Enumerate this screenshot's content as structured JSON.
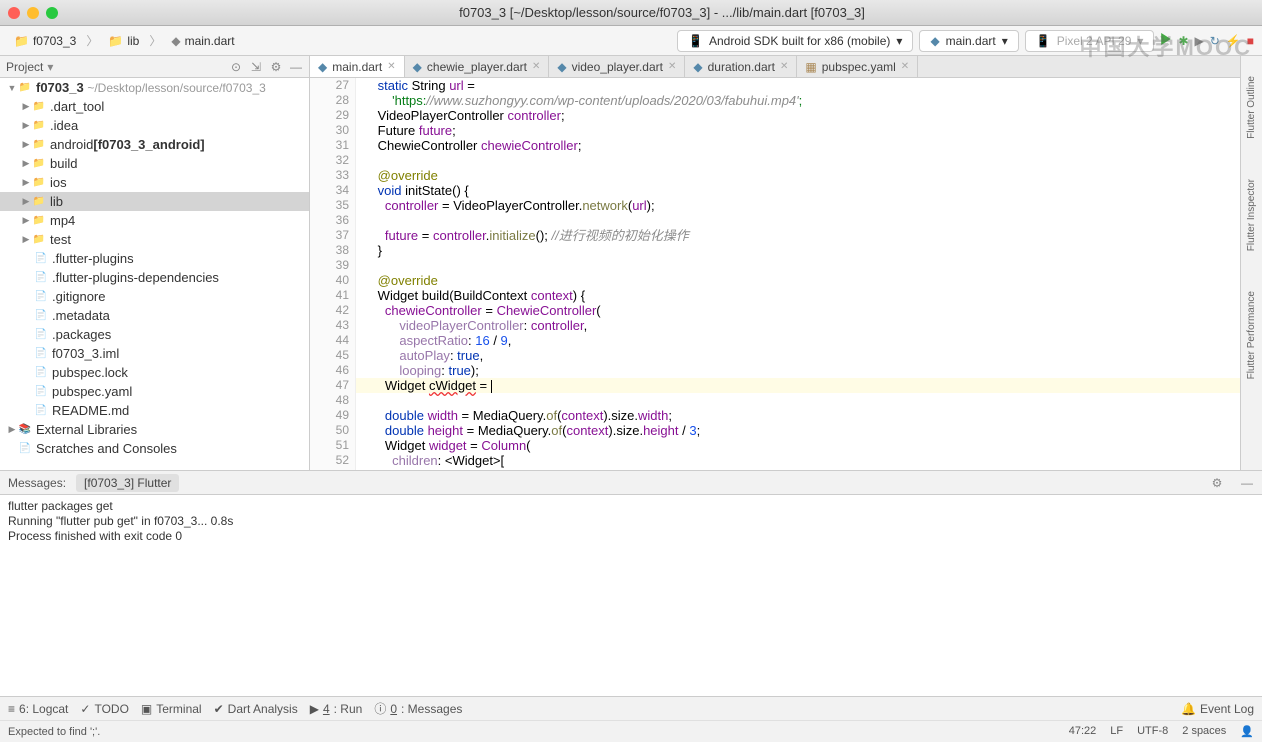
{
  "window": {
    "title": "f0703_3 [~/Desktop/lesson/source/f0703_3] - .../lib/main.dart [f0703_3]"
  },
  "breadcrumbs": {
    "project": "f0703_3",
    "folder": "lib",
    "file": "main.dart"
  },
  "toolbar": {
    "device": "Android SDK built for x86 (mobile)",
    "runconfig": "main.dart",
    "pixel": "Pixel 2 API 29"
  },
  "watermark": "中国大学MOOC",
  "project_panel": {
    "title": "Project",
    "root": "f0703_3",
    "root_path": "~/Desktop/lesson/source/f0703_3",
    "items": [
      ".dart_tool",
      ".idea",
      "android [f0703_3_android]",
      "build",
      "ios",
      "lib",
      "mp4",
      "test",
      ".flutter-plugins",
      ".flutter-plugins-dependencies",
      ".gitignore",
      ".metadata",
      ".packages",
      "f0703_3.iml",
      "pubspec.lock",
      "pubspec.yaml",
      "README.md"
    ],
    "ext_lib": "External Libraries",
    "scratches": "Scratches and Consoles"
  },
  "tabs": [
    {
      "label": "main.dart",
      "active": true
    },
    {
      "label": "chewie_player.dart",
      "active": false
    },
    {
      "label": "video_player.dart",
      "active": false
    },
    {
      "label": "duration.dart",
      "active": false
    },
    {
      "label": "pubspec.yaml",
      "active": false
    }
  ],
  "editor": {
    "first_line": 27,
    "lines": [
      "  static String url =",
      "      'https://www.suzhongyy.com/wp-content/uploads/2020/03/fabuhui.mp4';",
      "  VideoPlayerController controller;",
      "  Future future;",
      "  ChewieController chewieController;",
      "",
      "  @override",
      "  void initState() {",
      "    controller = VideoPlayerController.network(url);",
      "",
      "    future = controller.initialize(); //进行视频的初始化操作",
      "  }",
      "",
      "  @override",
      "  Widget build(BuildContext context) {",
      "    chewieController = ChewieController(",
      "        videoPlayerController: controller,",
      "        aspectRatio: 16 / 9,",
      "        autoPlay: true,",
      "        looping: true);",
      "    Widget cWidget = ",
      "",
      "    double width = MediaQuery.of(context).size.width;",
      "    double height = MediaQuery.of(context).size.height / 3;",
      "    Widget widget = Column(",
      "      children: <Widget>["
    ]
  },
  "right_rail": [
    "Flutter Outline",
    "Flutter Inspector",
    "Flutter Performance"
  ],
  "messages": {
    "label": "Messages:",
    "tab": "[f0703_3] Flutter",
    "lines": [
      "flutter packages get",
      "Running \"flutter pub get\" in f0703_3...                            0.8s",
      "Process finished with exit code 0"
    ]
  },
  "bottom": {
    "logcat": "6: Logcat",
    "todo": "TODO",
    "terminal": "Terminal",
    "dart": "Dart Analysis",
    "run": "4: Run",
    "messages": "0: Messages",
    "eventlog": "Event Log"
  },
  "status": {
    "msg": "Expected to find ';'.",
    "pos": "47:22",
    "lf": "LF",
    "enc": "UTF-8",
    "indent": "2 spaces"
  }
}
